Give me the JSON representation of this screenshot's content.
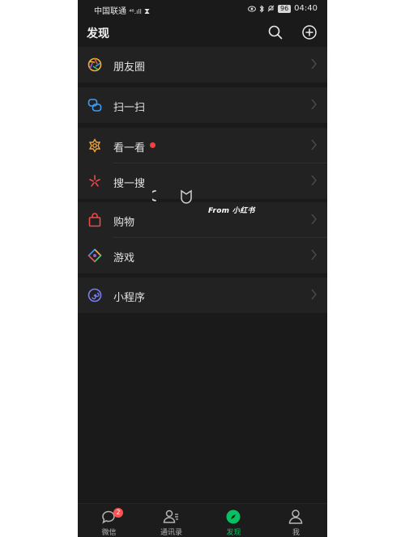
{
  "status_bar": {
    "carrier": "中国联通",
    "signal": "⁴⁶.ıll",
    "battery": "96",
    "time": "04:40"
  },
  "header": {
    "title": "发现"
  },
  "menu": {
    "moments": "朋友圈",
    "scan": "扫一扫",
    "top_stories": "看一看",
    "search": "搜一搜",
    "shopping": "购物",
    "games": "游戏",
    "mini_programs": "小程序"
  },
  "overlay": {
    "watermark": "From 小红书"
  },
  "tabbar": {
    "chats": "微信",
    "chats_badge": "2",
    "contacts": "通讯录",
    "discover": "发现",
    "me": "我"
  },
  "colors": {
    "accent": "#07c160",
    "badge": "#fa5151",
    "background": "#1a1a1a",
    "cell": "#222222"
  }
}
